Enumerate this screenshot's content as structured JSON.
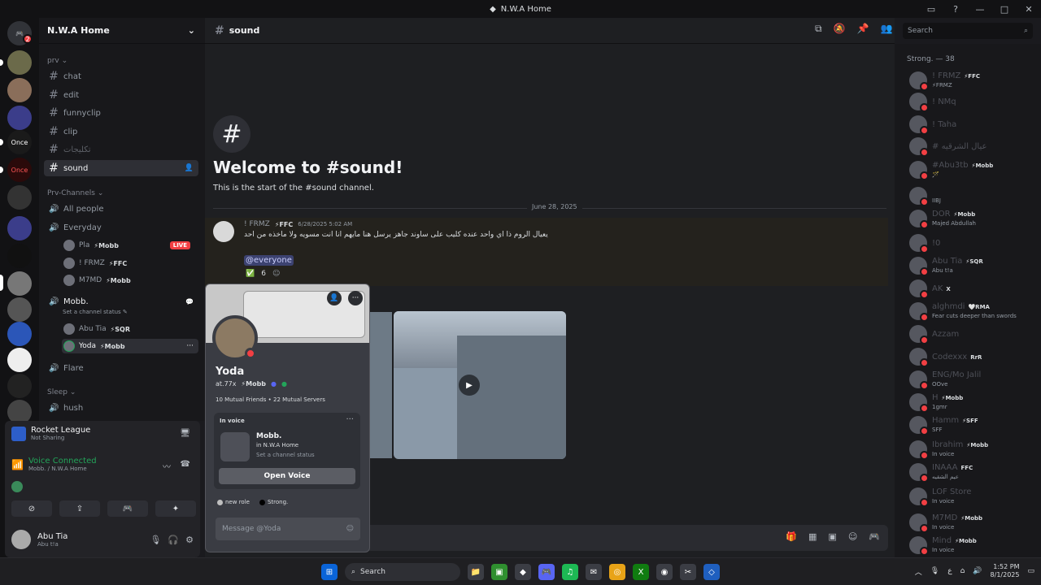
{
  "window": {
    "title": "N.W.A Home"
  },
  "guilds": {
    "dm_badge": "2",
    "labels": [
      "Once",
      "Once"
    ]
  },
  "server": {
    "name": "N.W.A Home"
  },
  "channels": {
    "cat_prv": "prv",
    "text": [
      "chat",
      "edit",
      "funnyclip",
      "clip",
      "تكليجات",
      "sound"
    ],
    "cat_prv_channels": "Prv-Channels",
    "voice_all": "All people",
    "voice_everyday": "Everyday",
    "everyday_users": [
      {
        "name": "Pla",
        "tag": "⚡Mobb",
        "live": "LIVE"
      },
      {
        "name": "! FRMZ",
        "tag": "⚡FFC"
      },
      {
        "name": "M7MD",
        "tag": "⚡Mobb"
      }
    ],
    "voice_mobb": "Mobb.",
    "mobb_status": "Set a channel status",
    "mobb_users": [
      {
        "name": "Abu Tia",
        "tag": "⚡SQR"
      },
      {
        "name": "Yoda",
        "tag": "⚡Mobb"
      }
    ],
    "voice_flare": "Flare",
    "cat_sleep": "Sleep",
    "voice_hush": "hush"
  },
  "activity": {
    "game": "Rocket League",
    "game_status": "Not Sharing",
    "voice_connected": "Voice Connected",
    "voice_location": "Mobb. / N.W.A Home"
  },
  "user_panel": {
    "name": "Abu Tia",
    "status": "Abu t!a"
  },
  "chat": {
    "channel": "sound",
    "welcome_title": "Welcome to #sound!",
    "welcome_sub": "This is the start of the #sound channel.",
    "date_divider": "June 28, 2025",
    "message": {
      "author": "! FRMZ",
      "tag": "⚡FFC",
      "time": "6/28/2025 5:02 AM",
      "text": "يعيال الروم ذا اي واحد عنده كليب على ساوند جاهز يرسل هنا مايهم انا انت مسويه ولا ماخذه من احد",
      "mention": "@everyone",
      "reaction": "✅",
      "reaction_count": "6"
    },
    "search_placeholder": "Search"
  },
  "members": {
    "header": "Strong. — 38",
    "list": [
      {
        "name": "! FRMZ",
        "tag": "⚡FFC",
        "sub": "⚡FRMZ"
      },
      {
        "name": "! NMq",
        "tag": "",
        "sub": ""
      },
      {
        "name": "! Taha",
        "tag": "",
        "sub": ""
      },
      {
        "name": "# عيال الشرقيه",
        "tag": "",
        "sub": ""
      },
      {
        "name": "#Abu3tb",
        "tag": "⚡Mobb",
        "sub": "🪄"
      },
      {
        "name": "",
        "tag": "",
        "sub": "IIBJ"
      },
      {
        "name": "DOR",
        "tag": "⚡Mobb",
        "sub": "Majed Abdullah"
      },
      {
        "name": "!0",
        "tag": "",
        "sub": ""
      },
      {
        "name": "Abu Tia",
        "tag": "⚡SQR",
        "sub": "Abu t!a"
      },
      {
        "name": "AK",
        "tag": "X",
        "sub": ""
      },
      {
        "name": "alghmdi",
        "tag": "🤍RMA",
        "sub": "Fear cuts deeper than swords"
      },
      {
        "name": "Azzam",
        "tag": "",
        "sub": ""
      },
      {
        "name": "Codexxx",
        "tag": "RrR",
        "sub": ""
      },
      {
        "name": "ENG/Mo Jalil",
        "tag": "",
        "sub": "OOve"
      },
      {
        "name": "H",
        "tag": "⚡Mobb",
        "sub": "1gmr"
      },
      {
        "name": "Hamm",
        "tag": "⚡SFF",
        "sub": "SFF"
      },
      {
        "name": "Ibrahim",
        "tag": "⚡Mobb",
        "sub": "In voice"
      },
      {
        "name": "INAAA",
        "tag": "FFC",
        "sub": "عيم الشقيه"
      },
      {
        "name": "LOF Store",
        "tag": "",
        "sub": "In voice"
      },
      {
        "name": "M7MD",
        "tag": "⚡Mobb",
        "sub": "In voice"
      },
      {
        "name": "Mind",
        "tag": "⚡Mobb",
        "sub": "In voice"
      }
    ]
  },
  "popout": {
    "name": "Yoda",
    "username": "at.77x",
    "tag": "⚡Mobb",
    "mutuals": "10 Mutual Friends • 22 Mutual Servers",
    "in_voice_label": "In voice",
    "voice_channel": "Mobb.",
    "voice_server": "in N.W.A Home",
    "voice_status": "Set a channel status",
    "open_voice": "Open Voice",
    "roles": [
      "new role",
      "Strong."
    ],
    "message_placeholder": "Message @Yoda"
  },
  "taskbar": {
    "search": "Search",
    "time": "1:52 PM",
    "date": "8/1/2025",
    "lang": "ع"
  },
  "colors": {
    "accent": "#5865f2",
    "dnd": "#f23f43",
    "online": "#23a55a",
    "bg": "#1e1f22"
  }
}
